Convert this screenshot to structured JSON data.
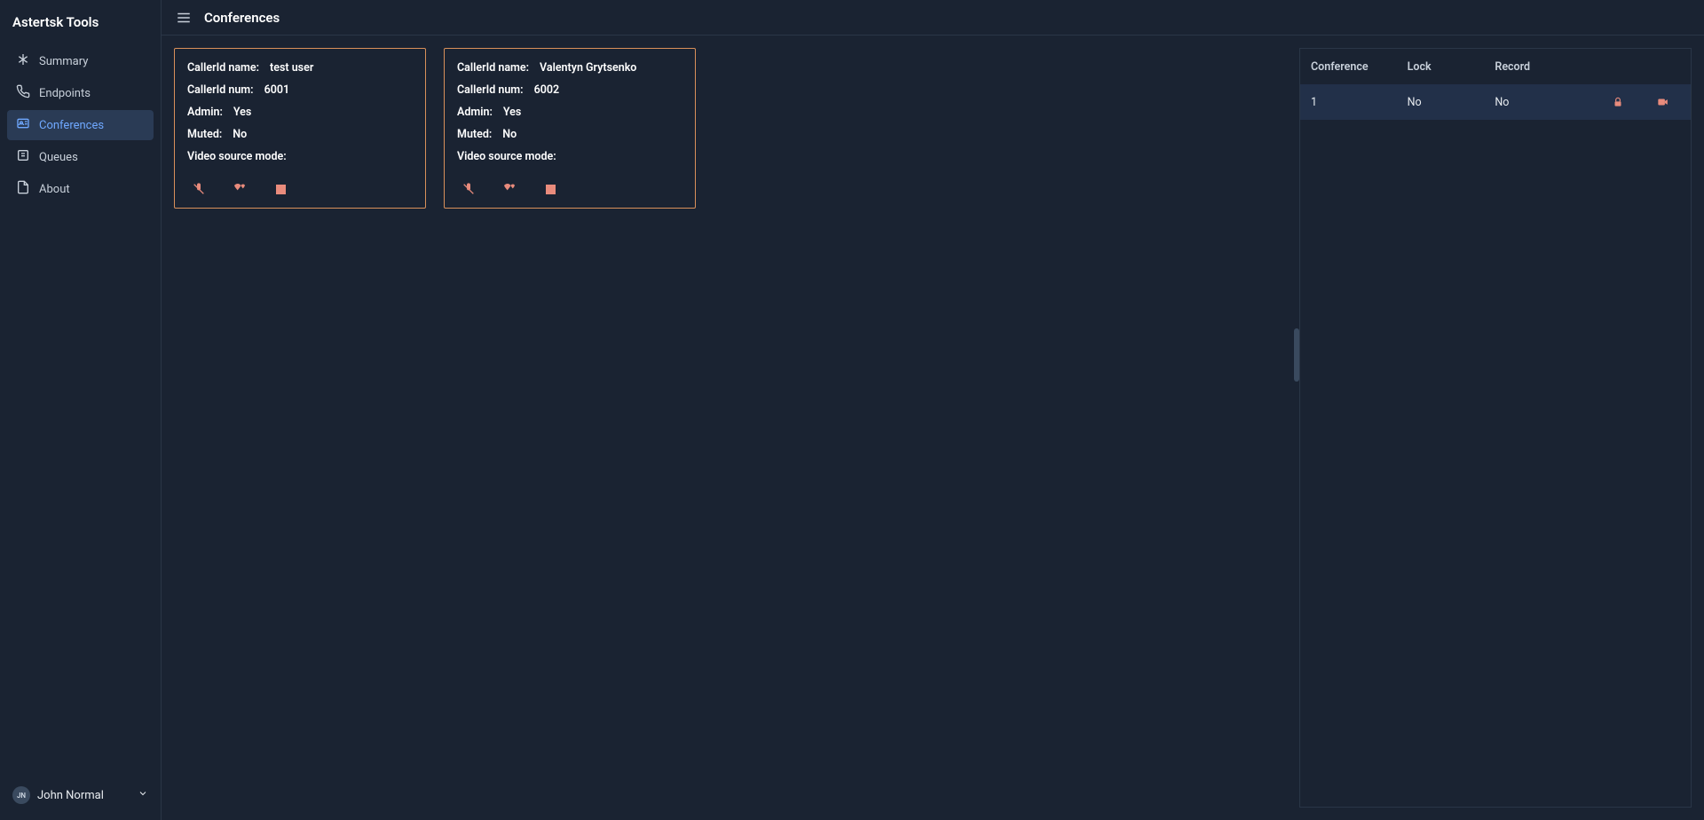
{
  "app": {
    "title": "Astertsk Tools"
  },
  "nav": {
    "items": [
      {
        "label": "Summary"
      },
      {
        "label": "Endpoints"
      },
      {
        "label": "Conferences"
      },
      {
        "label": "Queues"
      },
      {
        "label": "About"
      }
    ]
  },
  "user": {
    "initials": "JN",
    "name": "John Normal"
  },
  "page": {
    "title": "Conferences"
  },
  "labels": {
    "callerIdName": "CallerId name:",
    "callerIdNum": "CallerId num:",
    "admin": "Admin:",
    "muted": "Muted:",
    "videoSource": "Video source mode:"
  },
  "participants": [
    {
      "callerIdName": "test user",
      "callerIdNum": "6001",
      "admin": "Yes",
      "muted": "No",
      "videoSource": ""
    },
    {
      "callerIdName": "Valentyn Grytsenko",
      "callerIdNum": "6002",
      "admin": "Yes",
      "muted": "No",
      "videoSource": ""
    }
  ],
  "table": {
    "headers": {
      "conference": "Conference",
      "lock": "Lock",
      "record": "Record"
    },
    "rows": [
      {
        "conference": "1",
        "lock": "No",
        "record": "No"
      }
    ]
  }
}
